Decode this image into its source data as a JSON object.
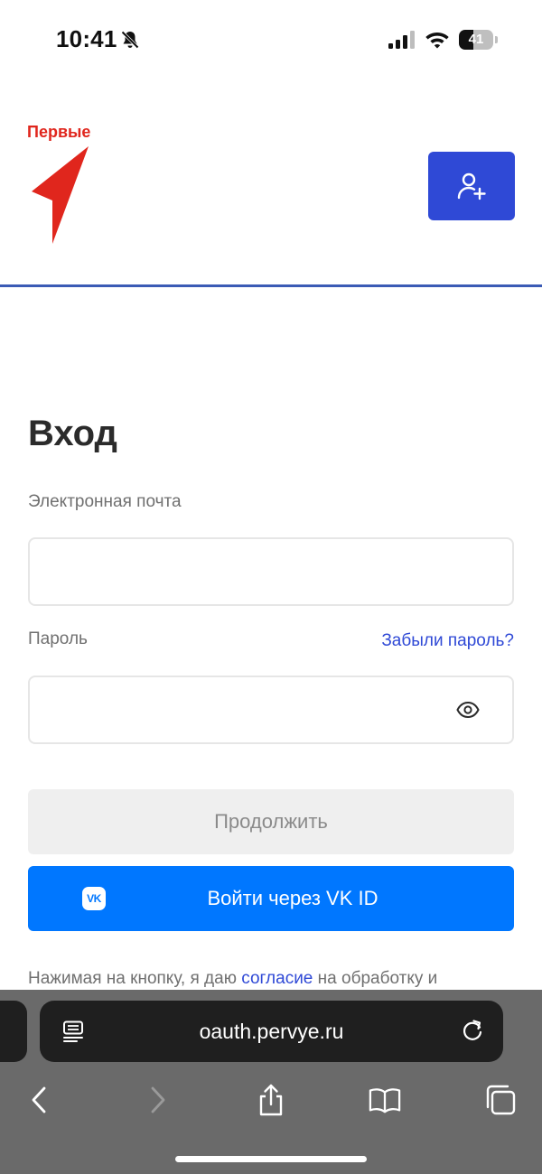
{
  "status_bar": {
    "time": "10:41",
    "battery_level": "41",
    "battery_fraction": 0.41,
    "icons": [
      "bell-off-icon",
      "signal-icon",
      "wifi-icon",
      "battery-icon"
    ]
  },
  "header": {
    "logo_text": "Первые",
    "logo_color": "#e0261d",
    "register_icon": "add-user-icon",
    "accent_color": "#2f49d6"
  },
  "login": {
    "title": "Вход",
    "email_label": "Электронная почта",
    "email_value": "",
    "password_label": "Пароль",
    "password_value": "",
    "forgot_password": "Забыли пароль?",
    "continue_label": "Продолжить",
    "vk_label": "Войти через VK ID",
    "vk_logo": "VK",
    "vk_color": "#0077ff",
    "consent_prefix": "Нажимая на кнопку, я даю ",
    "consent_link": "согласие",
    "consent_suffix": " на обработку и"
  },
  "browser": {
    "url": "oauth.pervye.ru",
    "toolbar_icons": [
      "back-icon",
      "forward-icon",
      "share-icon",
      "bookmarks-icon",
      "tabs-icon"
    ]
  }
}
